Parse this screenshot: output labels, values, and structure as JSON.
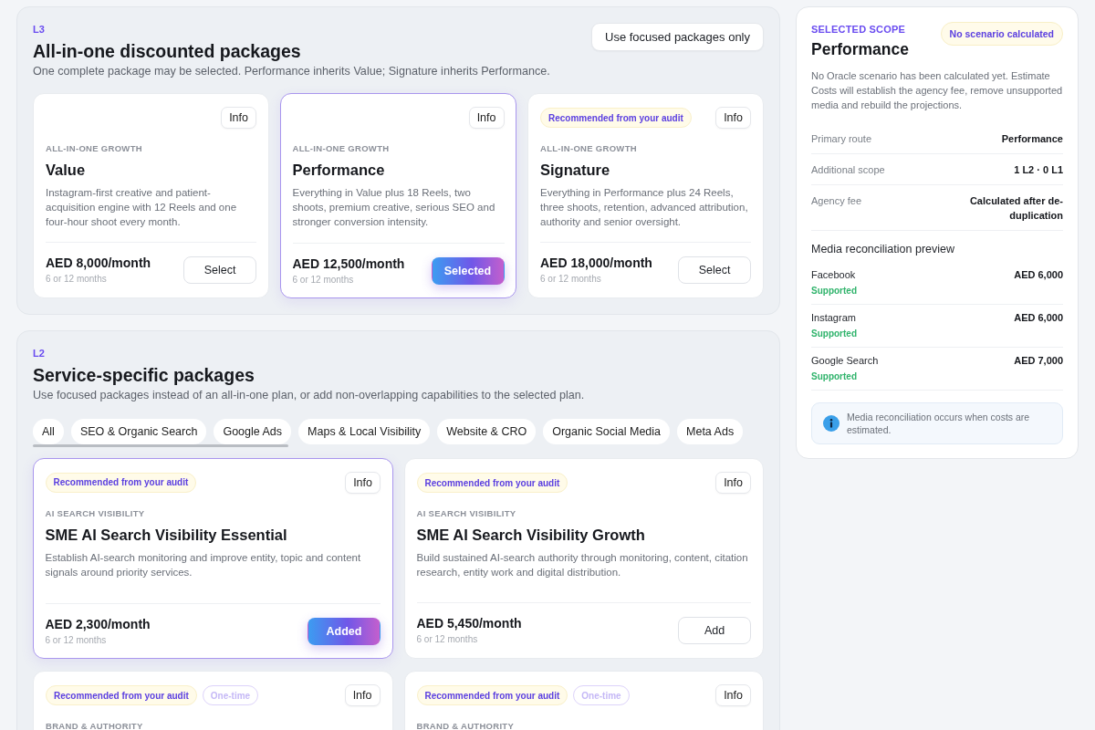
{
  "bundles": {
    "level_tag": "L3",
    "title": "All-in-one discounted packages",
    "subtitle": "One complete package may be selected. Performance inherits Value; Signature inherits Performance.",
    "toggle_button": "Use focused packages only",
    "cards": [
      {
        "info_button": "Info",
        "eyebrow": "ALL-IN-ONE GROWTH",
        "name": "Value",
        "description": "Instagram-first creative and patient-acquisition engine with 12 Reels and one four-hour shoot every month.",
        "price": "AED 8,000/month",
        "term": "6 or 12 months",
        "action": "Select",
        "selected": false
      },
      {
        "info_button": "Info",
        "eyebrow": "ALL-IN-ONE GROWTH",
        "name": "Performance",
        "description": "Everything in Value plus 18 Reels, two shoots, premium creative, serious SEO and stronger conversion intensity.",
        "price": "AED 12,500/month",
        "term": "6 or 12 months",
        "action": "Selected",
        "selected": true
      },
      {
        "badges": [
          {
            "text": "Recommended from your audit",
            "kind": "recommended"
          }
        ],
        "info_button": "Info",
        "eyebrow": "ALL-IN-ONE GROWTH",
        "name": "Signature",
        "description": "Everything in Performance plus 24 Reels, three shoots, retention, advanced attribution, authority and senior oversight.",
        "price": "AED 18,000/month",
        "term": "6 or 12 months",
        "action": "Select",
        "selected": false
      }
    ]
  },
  "services": {
    "level_tag": "L2",
    "title": "Service-specific packages",
    "subtitle": "Use focused packages instead of an all-in-one plan, or add non-overlapping capabilities to the selected plan.",
    "tabs": [
      {
        "label": "All",
        "selected": false
      },
      {
        "label": "SEO & Organic Search",
        "selected": false
      },
      {
        "label": "Google Ads",
        "selected": false
      },
      {
        "label": "Maps & Local Visibility",
        "selected": false
      },
      {
        "label": "Website & CRO",
        "selected": false
      },
      {
        "label": "Organic Social Media",
        "selected": false
      },
      {
        "label": "Meta Ads",
        "selected": false
      }
    ],
    "cards": [
      {
        "badges": [
          {
            "text": "Recommended from your audit",
            "kind": "recommended"
          }
        ],
        "info_button": "Info",
        "eyebrow": "AI SEARCH VISIBILITY",
        "name": "SME AI Search Visibility Essential",
        "description": "Establish AI-search monitoring and improve entity, topic and content signals around priority services.",
        "price": "AED 2,300/month",
        "term": "6 or 12 months",
        "action": "Added",
        "selected": true
      },
      {
        "badges": [
          {
            "text": "Recommended from your audit",
            "kind": "recommended"
          }
        ],
        "info_button": "Info",
        "eyebrow": "AI SEARCH VISIBILITY",
        "name": "SME AI Search Visibility Growth",
        "description": "Build sustained AI-search authority through monitoring, content, citation research, entity work and digital distribution.",
        "price": "AED 5,450/month",
        "term": "6 or 12 months",
        "action": "Add",
        "selected": false
      },
      {
        "badges": [
          {
            "text": "Recommended from your audit",
            "kind": "recommended"
          },
          {
            "text": "One-time",
            "kind": "one-time"
          }
        ],
        "info_button": "Info",
        "eyebrow": "BRAND & AUTHORITY"
      },
      {
        "badges": [
          {
            "text": "Recommended from your audit",
            "kind": "recommended"
          },
          {
            "text": "One-time",
            "kind": "one-time"
          }
        ],
        "info_button": "Info",
        "eyebrow": "BRAND & AUTHORITY"
      }
    ]
  },
  "scope": {
    "eyebrow": "SELECTED SCOPE",
    "status_badge": "No scenario calculated",
    "title": "Performance",
    "description": "No Oracle scenario has been calculated yet. Estimate Costs will establish the agency fee, remove unsupported media and rebuild the projections.",
    "rows": [
      {
        "label": "Primary route",
        "value": "Performance"
      },
      {
        "label": "Additional scope",
        "value": "1 L2 · 0 L1"
      },
      {
        "label": "Agency fee",
        "value": "Calculated after de-duplication"
      }
    ],
    "media_title": "Media reconciliation preview",
    "media": [
      {
        "name": "Facebook",
        "amount": "AED 6,000",
        "status": "Supported"
      },
      {
        "name": "Instagram",
        "amount": "AED 6,000",
        "status": "Supported"
      },
      {
        "name": "Google Search",
        "amount": "AED 7,000",
        "status": "Supported"
      }
    ],
    "note": "Media reconciliation occurs when costs are estimated."
  }
}
